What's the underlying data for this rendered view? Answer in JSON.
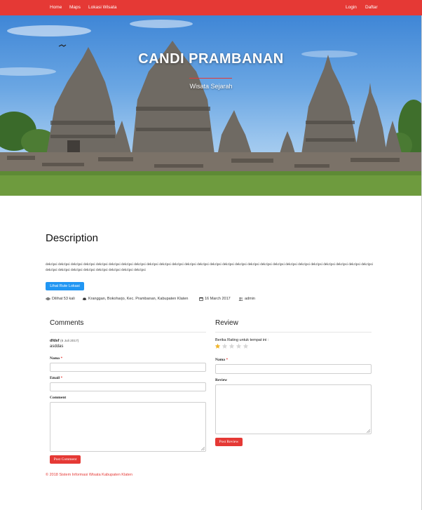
{
  "navbar": {
    "links": [
      "Home",
      "Maps",
      "Lokasi Wisata"
    ],
    "login": "Login",
    "register": "Daftar"
  },
  "hero": {
    "title": "CANDI PRAMBANAN",
    "subtitle": "Wisata Sejarah"
  },
  "description": {
    "heading": "Description",
    "text": "dekripsi dekripsi dekripsi dekripsi dekripsi dekripsi dekripsi dekripsi dekripsi dekripsi dekripsi dekripsi dekripsi dekripsi dekripsi dekripsi dekripsi dekripsi dekripsi dekripsi dekripsi dekripsi dekripsi dekripsi dekripsi dekripsi dekripsi dekripsi dekripsi dekripsi dekripsi dekripsi dekripsi dekripsi",
    "route_button": "Lihat Rute Lokasi"
  },
  "meta": {
    "views": "Dilihat 53 kali",
    "address": "Kranggan, Bokoharjo, Kec. Prambanan, Kabupaten Klaten",
    "date": "16 March 2017",
    "author": "admin"
  },
  "comments": {
    "heading": "Comments",
    "items": [
      {
        "author": "dfdsf",
        "date": "(6 Juli 2017)",
        "body": "asddas"
      }
    ],
    "form": {
      "name_label": "Nama",
      "email_label": "Email",
      "comment_label": "Comment",
      "required_mark": "*",
      "submit": "Post Comment"
    }
  },
  "review": {
    "heading": "Review",
    "rating_label": "Berika Rating untuk tempat ini :",
    "rating": 1,
    "max_rating": 5,
    "form": {
      "name_label": "Nama",
      "review_label": "Review",
      "required_mark": "*",
      "submit": "Post Review"
    }
  },
  "footer": {
    "text": "© 2018 Sistem Informasi Wisata Kabupaten Klaten"
  },
  "colors": {
    "brand_red": "#e53935",
    "button_blue": "#2196f3",
    "star_filled": "#f0b429",
    "star_empty": "#d6d6d6"
  },
  "icons": [
    "eye-icon",
    "car-icon",
    "calendar-icon",
    "users-icon",
    "star-icon"
  ]
}
